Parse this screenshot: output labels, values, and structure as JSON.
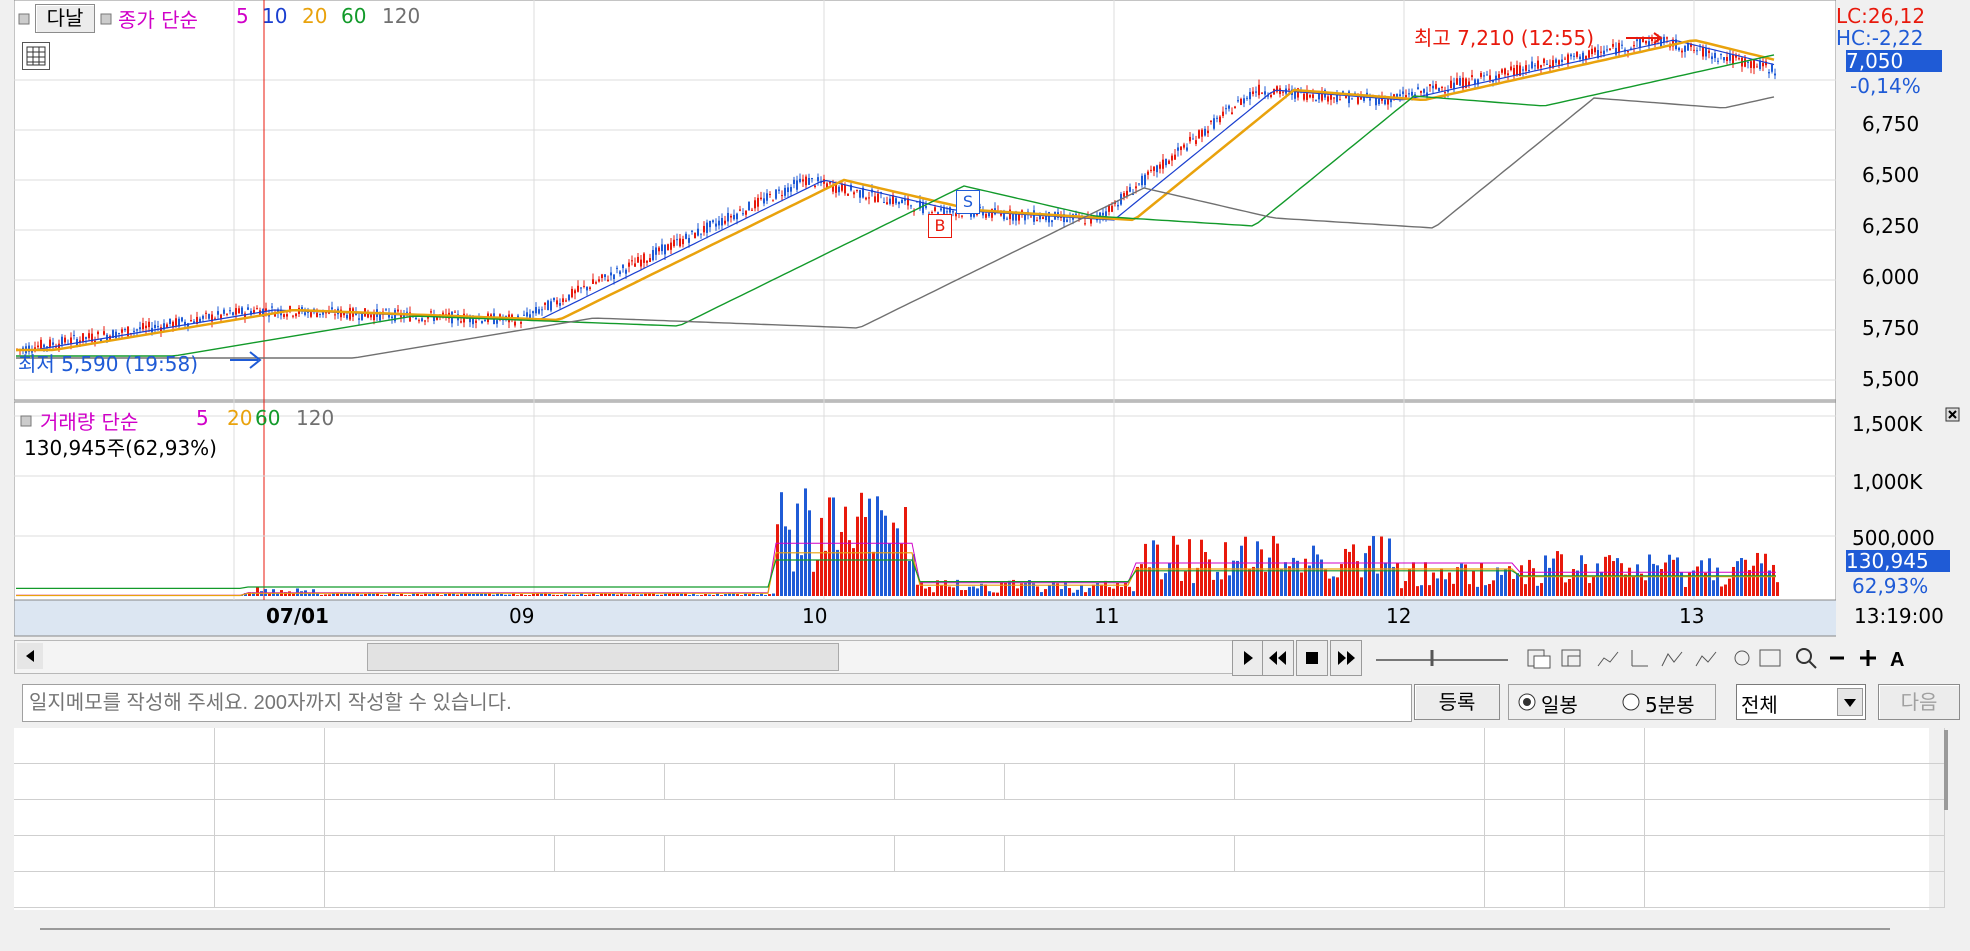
{
  "toolbar_top": {
    "period_button": "다날",
    "price_legend": {
      "prefix": "종가 단순",
      "ma": [
        "5",
        "10",
        "20",
        "60",
        "120"
      ]
    },
    "volume_legend": {
      "prefix": "거래량 단순",
      "ma": [
        "5",
        "20",
        "60",
        "120"
      ]
    },
    "volume_value": "130,945주(62,93%)"
  },
  "price_axis": {
    "labels": [
      "6,750",
      "6,500",
      "6,250",
      "6,000",
      "5,750",
      "5,500"
    ],
    "lc": "LC:26,12",
    "hc": "HC:-2,22",
    "current": "7,050",
    "change": "-0,14%"
  },
  "volume_axis": {
    "labels": [
      "1,500K",
      "1,000K",
      "500,000"
    ],
    "current": "130,945",
    "percent": "62,93%"
  },
  "annotations": {
    "high": "최고 7,210 (12:55)",
    "low": "최저 5,590 (19:58)",
    "buy": "B",
    "sell": "S"
  },
  "x_axis": {
    "labels": [
      "07/01",
      "09",
      "10",
      "11",
      "12",
      "13"
    ],
    "time": "13:19:00"
  },
  "memo": {
    "placeholder": "일지메모를 작성해 주세요. 200자까지 작성할 수 있습니다.",
    "register_button": "등록",
    "radio_daily": "일봉",
    "radio_5min": "5분봉",
    "filter_select": "전체",
    "next_button": "다음"
  },
  "colors": {
    "up": "#e8190c",
    "down": "#1f5bd6",
    "ma5": "#1a3fd0",
    "ma10": "#1a3fd0",
    "ma20": "#e9a20c",
    "ma60": "#129a2a",
    "ma120": "#707070",
    "axis_highlight": "#1f5bd6"
  },
  "chart_data": {
    "type": "candlestick",
    "x": [
      "07/01",
      "09",
      "10",
      "11",
      "12",
      "13"
    ],
    "ylim": [
      5500,
      7200
    ],
    "closes": [
      {
        "x": "07/01 start",
        "y": 5650
      },
      {
        "x": "07/01",
        "y": 5850
      },
      {
        "x": "09",
        "y": 5800
      },
      {
        "x": "10 open",
        "y": 6500
      },
      {
        "x": "10 mid",
        "y": 6350
      },
      {
        "x": "11",
        "y": 6300
      },
      {
        "x": "11 late",
        "y": 6950
      },
      {
        "x": "12",
        "y": 6900
      },
      {
        "x": "12 late",
        "y": 7200
      },
      {
        "x": "13",
        "y": 7050
      }
    ],
    "high": {
      "value": 7210,
      "time": "12:55"
    },
    "low": {
      "value": 5590,
      "time": "19:58"
    },
    "volume": {
      "last": 130945,
      "ylim": [
        0,
        1500000
      ]
    }
  }
}
